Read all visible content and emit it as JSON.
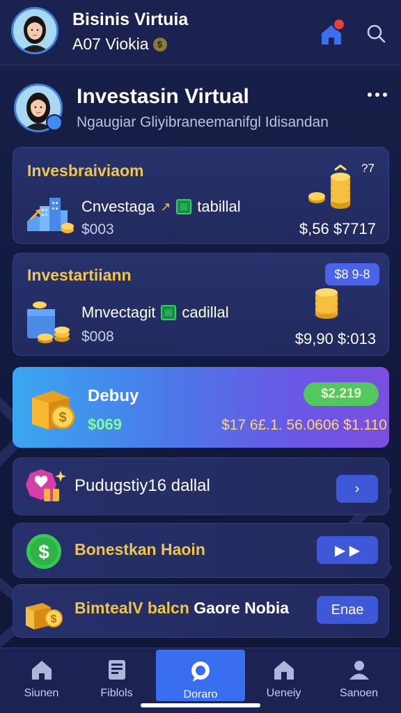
{
  "topbar": {
    "title": "Bisinis Virtuia",
    "subtitle": "A07 Viokia",
    "coin_glyph": "$"
  },
  "profile": {
    "title": "Investasin Virtual",
    "subtitle": "Ngaugiar Gliyibraneemanifgl Idisandan"
  },
  "card1": {
    "title": "Invesbraiviaom",
    "label_a": "Cnvestaga",
    "label_b": "tabillal",
    "amount": "$003",
    "value": "$,56 $7717",
    "corner": "?7"
  },
  "card2": {
    "title": "Investartiiann",
    "label_a": "Mnvectagit",
    "label_b": "cadillal",
    "amount": "$008",
    "value": "$9,90 $:013",
    "badge": "$8 9-8"
  },
  "feature": {
    "title": "Debuy",
    "amount": "$069",
    "values": "$17 6£.1. 56.0606 $1.110",
    "pill": "$2.219"
  },
  "rows": [
    {
      "label": "Pudugstiy16 dallal",
      "button": "›"
    },
    {
      "label": "Bonestkan Haoin",
      "button": "▶ ▶"
    },
    {
      "label_yellow": "BimtealV balcn",
      "label_white": " Gaore Nobia",
      "button": "Enae"
    }
  ],
  "nav": {
    "items": [
      {
        "label": "Siunen",
        "icon": "home-icon"
      },
      {
        "label": "Fiblols",
        "icon": "document-icon"
      },
      {
        "label": "Doraro",
        "icon": "chat-icon"
      },
      {
        "label": "Ueneiy",
        "icon": "house-icon"
      },
      {
        "label": "Sanoen",
        "icon": "user-icon"
      }
    ],
    "active_index": 2
  },
  "colors": {
    "accent_gold": "#f0c548",
    "accent_blue": "#3a6ef0",
    "positive_green": "#52c85e"
  }
}
